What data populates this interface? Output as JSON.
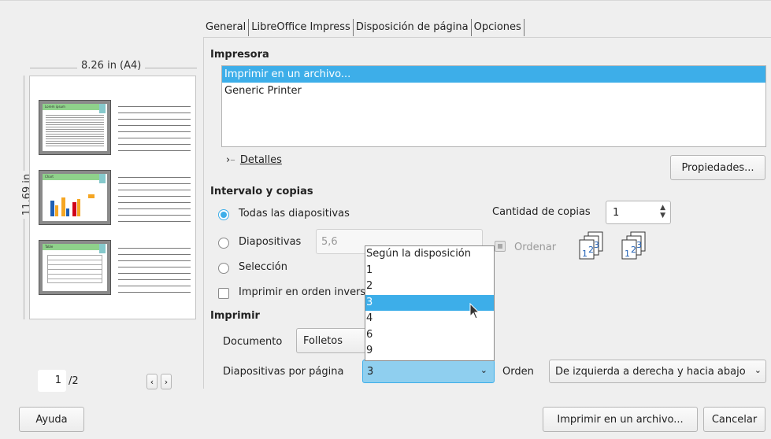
{
  "preview": {
    "width_label": "8.26 in (A4)",
    "height_label": "11.69 in",
    "slides": [
      {
        "title": "Lorem ipsum"
      },
      {
        "title": "Chart"
      },
      {
        "title": "Table"
      }
    ],
    "page_current": "1",
    "page_total": "/2",
    "prev_icon": "‹",
    "next_icon": "›"
  },
  "tabs": [
    "General",
    "LibreOffice Impress",
    "Disposición de página",
    "Opciones"
  ],
  "printer": {
    "title": "Impresora",
    "items": [
      "Imprimir en un archivo...",
      "Generic Printer"
    ],
    "details_label": "Detalles",
    "properties_button": "Propiedades..."
  },
  "range": {
    "title": "Intervalo y copias",
    "all_slides": "Todas las diapositivas",
    "slides": "Diapositivas",
    "slides_value": "5,6",
    "selection": "Selección",
    "reverse": "Imprimir en orden inverso",
    "copies_label": "Cantidad de copias",
    "copies_value": "1",
    "collate": "Ordenar"
  },
  "print_section": {
    "title": "Imprimir",
    "document_label": "Documento",
    "document_value": "Folletos",
    "slides_per_page_label": "Diapositivas por página",
    "slides_per_page_value": "3",
    "order_label": "Orden",
    "order_value": "De izquierda a derecha y hacia abajo"
  },
  "dropdown_options": [
    "Según la disposición",
    "1",
    "2",
    "3",
    "4",
    "6",
    "9"
  ],
  "dropdown_selected_index": 3,
  "footer": {
    "help": "Ayuda",
    "print": "Imprimir en un archivo...",
    "cancel": "Cancelar"
  },
  "colors": {
    "accent": "#3daee9"
  }
}
